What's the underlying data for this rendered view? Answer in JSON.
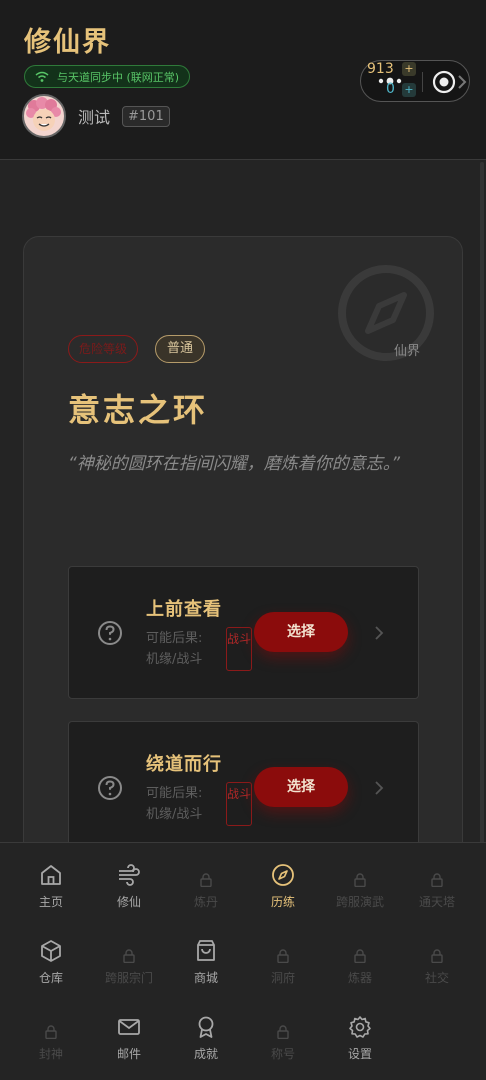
{
  "header": {
    "app_title": "修仙界",
    "sync_status": "与天道同步中 (联网正常)",
    "user_name": "测试",
    "user_id": "#101",
    "capsule": {
      "top_value": "913",
      "bottom_value": "0",
      "plus": "+"
    }
  },
  "event": {
    "danger_tag": "危险等级",
    "rarity_tag": "普通",
    "location": "仙界",
    "title": "意志之环",
    "description": "“神秘的圆环在指间闪耀，磨炼着你的意志。”",
    "choices": [
      {
        "title": "上前查看",
        "outcome_label": "可能后果:",
        "outcome_value": "机缘/战斗",
        "tag": "战斗",
        "button": "选择"
      },
      {
        "title": "绕道而行",
        "outcome_label": "可能后果:",
        "outcome_value": "机缘/战斗",
        "tag": "战斗",
        "button": "选择"
      }
    ]
  },
  "nav": {
    "items": [
      {
        "label": "主页",
        "icon": "home-icon",
        "locked": false
      },
      {
        "label": "修仙",
        "icon": "wind-icon",
        "locked": false
      },
      {
        "label": "炼丹",
        "icon": "lock-icon",
        "locked": true
      },
      {
        "label": "历练",
        "icon": "compass-icon",
        "locked": false,
        "active": true
      },
      {
        "label": "跨服演武",
        "icon": "lock-icon",
        "locked": true
      },
      {
        "label": "通天塔",
        "icon": "lock-icon",
        "locked": true
      },
      {
        "label": "仓库",
        "icon": "box-icon",
        "locked": false
      },
      {
        "label": "跨服宗门",
        "icon": "lock-icon",
        "locked": true
      },
      {
        "label": "商城",
        "icon": "shopping-bag-icon",
        "locked": false
      },
      {
        "label": "洞府",
        "icon": "lock-icon",
        "locked": true
      },
      {
        "label": "炼器",
        "icon": "lock-icon",
        "locked": true
      },
      {
        "label": "社交",
        "icon": "lock-icon",
        "locked": true
      },
      {
        "label": "封神",
        "icon": "lock-icon",
        "locked": true
      },
      {
        "label": "邮件",
        "icon": "mail-icon",
        "locked": false
      },
      {
        "label": "成就",
        "icon": "award-icon",
        "locked": false
      },
      {
        "label": "称号",
        "icon": "lock-icon",
        "locked": true
      },
      {
        "label": "设置",
        "icon": "gear-icon",
        "locked": false
      }
    ]
  },
  "colors": {
    "gold": "#e6c27a",
    "danger": "#8b0c0c",
    "sync_green": "#58c567"
  }
}
